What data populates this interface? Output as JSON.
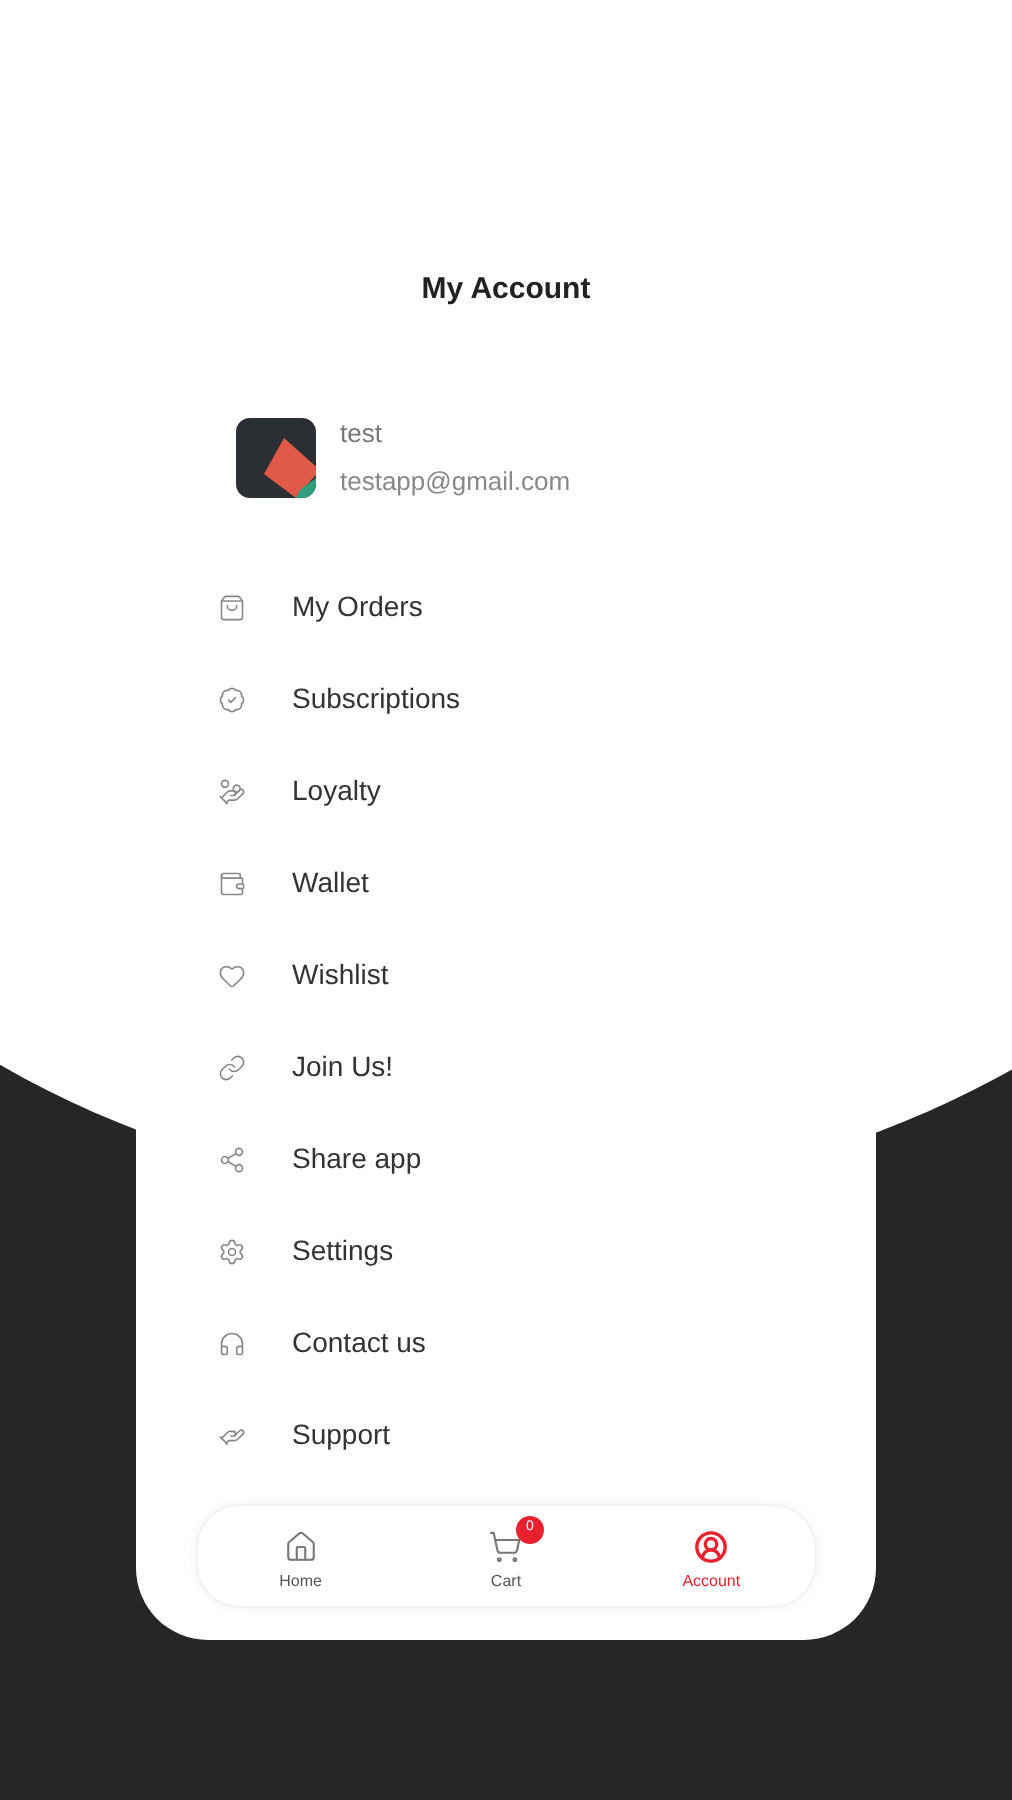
{
  "title": "My Account",
  "profile": {
    "name": "test",
    "email": "testapp@gmail.com"
  },
  "menu": [
    {
      "kind": "orders",
      "label": "My Orders"
    },
    {
      "kind": "subscriptions",
      "label": "Subscriptions"
    },
    {
      "kind": "loyalty",
      "label": "Loyalty"
    },
    {
      "kind": "wallet",
      "label": "Wallet"
    },
    {
      "kind": "wishlist",
      "label": "Wishlist"
    },
    {
      "kind": "join",
      "label": "Join Us!"
    },
    {
      "kind": "share",
      "label": "Share app"
    },
    {
      "kind": "settings",
      "label": "Settings"
    },
    {
      "kind": "contact",
      "label": "Contact us"
    },
    {
      "kind": "support",
      "label": "Support"
    }
  ],
  "nav": [
    {
      "kind": "home",
      "label": "Home",
      "selected": false
    },
    {
      "kind": "cart",
      "label": "Cart",
      "selected": false,
      "badge": "0"
    },
    {
      "kind": "account",
      "label": "Account",
      "selected": true
    }
  ]
}
